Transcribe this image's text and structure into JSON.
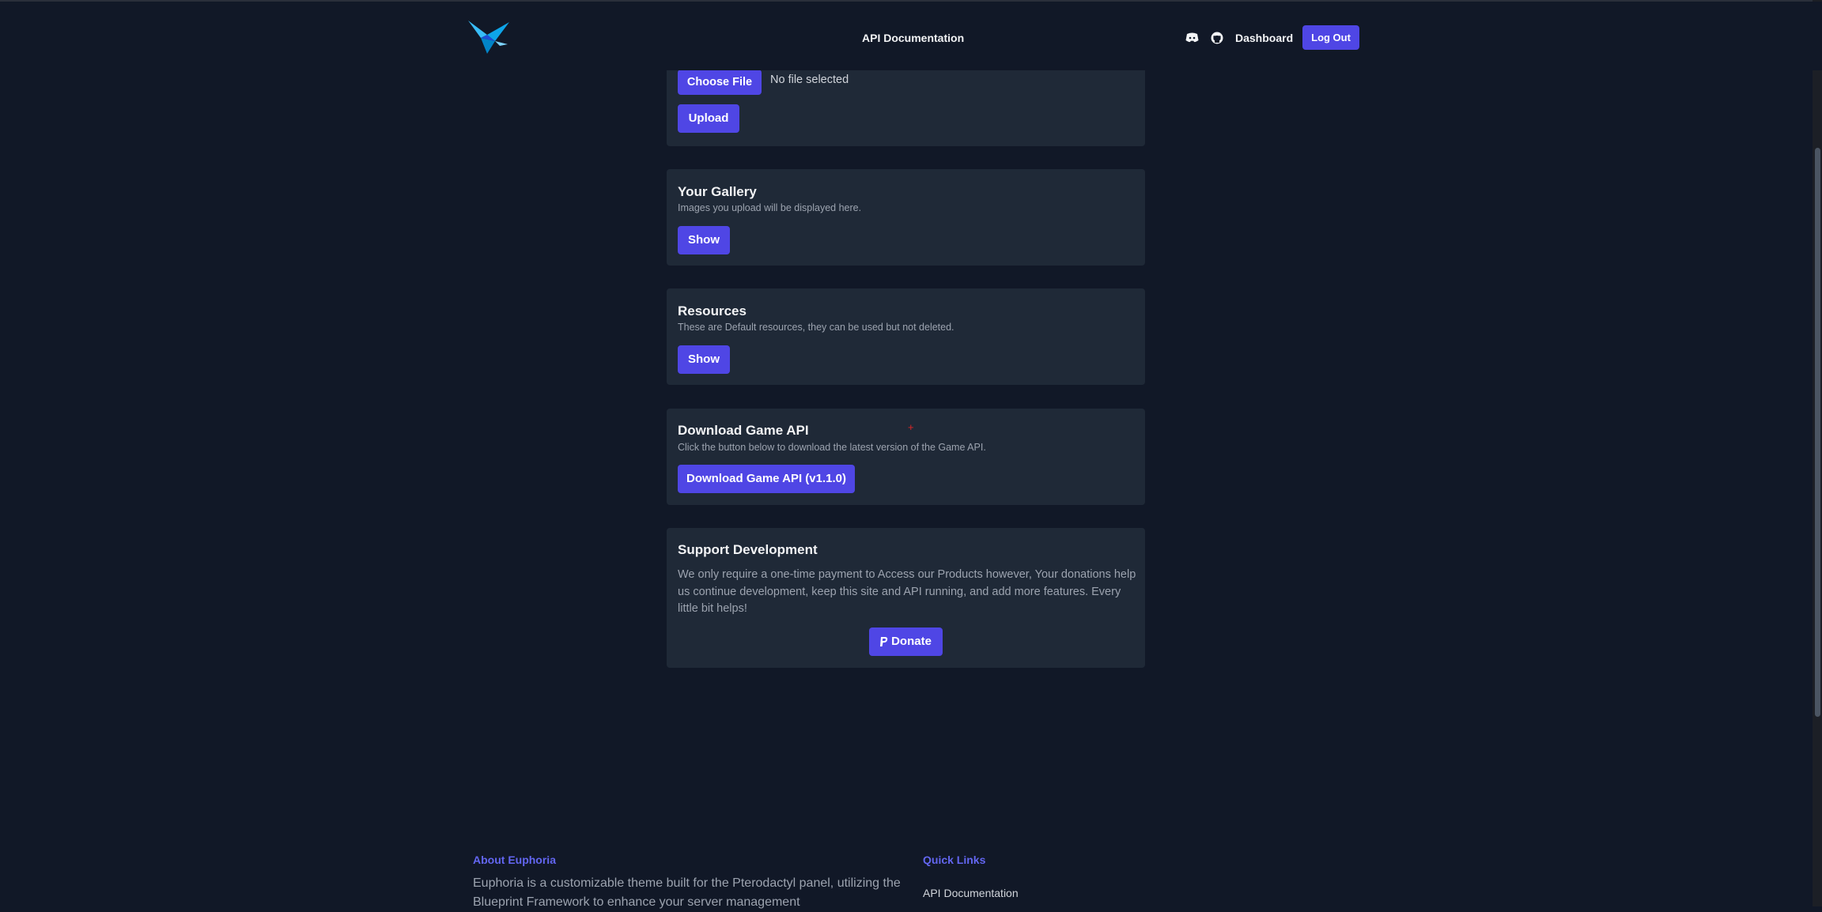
{
  "navbar": {
    "center_link": "API Documentation",
    "icons": [
      "discord-icon",
      "github-icon"
    ],
    "dashboard_label": "Dashboard",
    "logout_label": "Log Out"
  },
  "upload_card": {
    "choose_file_label": "Choose File",
    "file_status": "No file selected",
    "upload_label": "Upload"
  },
  "gallery_card": {
    "title": "Your Gallery",
    "description": "Images you upload will be displayed here.",
    "button_label": "Show"
  },
  "resources_card": {
    "title": "Resources",
    "description": "These are Default resources, they can be used but not deleted.",
    "button_label": "Show"
  },
  "download_card": {
    "title": "Download Game API",
    "description": "Click the button below to download the latest version of the Game API.",
    "button_label": "Download Game API (v1.1.0)"
  },
  "support_card": {
    "title": "Support Development",
    "text": "We only require a one-time payment to Access our Products however, Your donations help us continue development, keep this site and API running, and add more features. Every little bit helps!",
    "donate_icon": "paypal-icon",
    "donate_label": "Donate"
  },
  "footer": {
    "about_title": "About Euphoria",
    "about_text": "Euphoria is a customizable theme built for the Pterodactyl panel, utilizing the Blueprint Framework to enhance your server management",
    "quick_links_title": "Quick Links",
    "quick_links": [
      "API Documentation"
    ]
  },
  "colors": {
    "background": "#111827",
    "card": "#1f2937",
    "accent": "#4f46e5",
    "link_heading": "#6366f1"
  }
}
